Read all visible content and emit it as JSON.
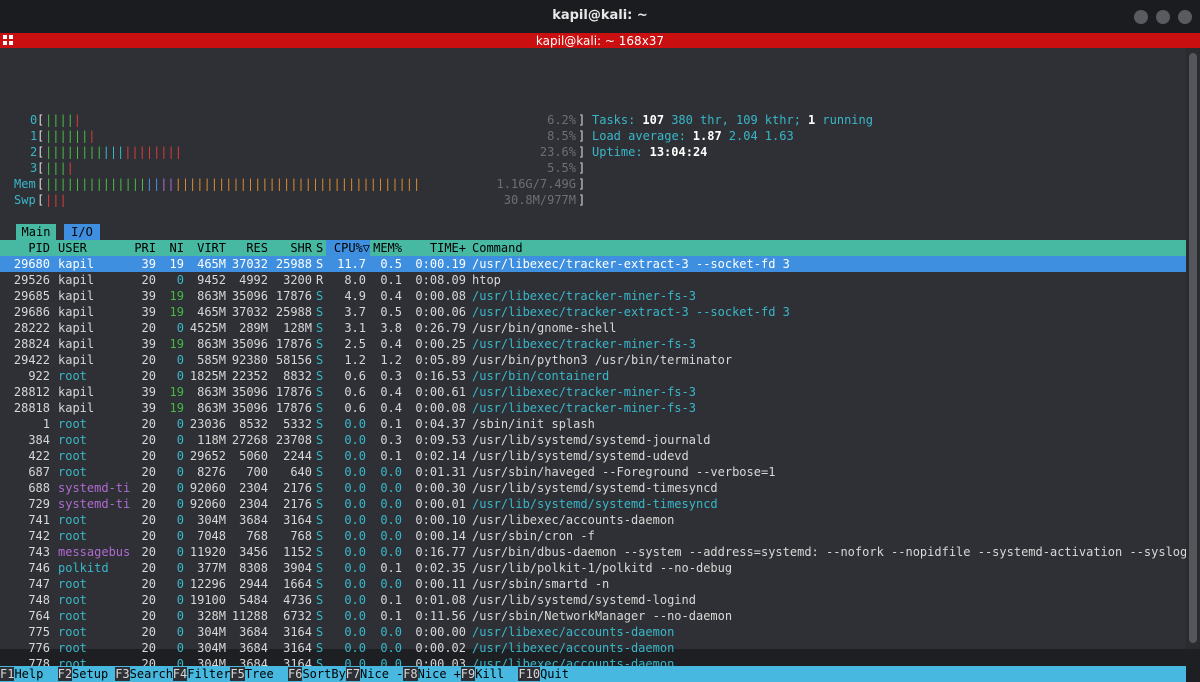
{
  "window": {
    "title": "kapil@kali: ~",
    "subtitle": "kapil@kali: ~ 168x37"
  },
  "meters": {
    "cpu": [
      {
        "label": "0",
        "value": "6.2%"
      },
      {
        "label": "1",
        "value": "8.5%"
      },
      {
        "label": "2",
        "value": "23.6%"
      },
      {
        "label": "3",
        "value": "5.5%"
      }
    ],
    "mem": {
      "label": "Mem",
      "value": "1.16G/7.49G"
    },
    "swp": {
      "label": "Swp",
      "value": "30.8M/977M"
    },
    "tasks": {
      "label": "Tasks:",
      "tasks": "107",
      "thr": "380",
      "thr_label": "thr,",
      "kthr": "109",
      "kthr_label": "kthr;",
      "running": "1",
      "running_label": "running"
    },
    "load": {
      "label": "Load average:",
      "v1": "1.87",
      "v2": "2.04",
      "v3": "1.63"
    },
    "uptime": {
      "label": "Uptime:",
      "value": "13:04:24"
    }
  },
  "tabs": [
    {
      "label": "Main"
    },
    {
      "label": "I/O"
    }
  ],
  "columns": {
    "pid": "PID",
    "user": "USER",
    "pri": "PRI",
    "ni": "NI",
    "virt": "VIRT",
    "res": "RES",
    "shr": "SHR",
    "s": "S",
    "cpu": "CPU%▽",
    "mem": "MEM%",
    "time": "TIME+",
    "cmd": "Command"
  },
  "processes": [
    {
      "pid": "29680",
      "user": "kapil",
      "pri": "39",
      "ni": "19",
      "virt": "465M",
      "res": "37032",
      "shr": "25988",
      "s": "S",
      "cpu": "11.7",
      "mem": "0.5",
      "time": "0:00.19",
      "cmd": "/usr/libexec/tracker-extract-3 --socket-fd 3"
    },
    {
      "pid": "29526",
      "user": "kapil",
      "pri": "20",
      "ni": "0",
      "virt": "9452",
      "res": "4992",
      "shr": "3200",
      "s": "R",
      "cpu": "8.0",
      "mem": "0.1",
      "time": "0:08.09",
      "cmd": "htop"
    },
    {
      "pid": "29685",
      "user": "kapil",
      "pri": "39",
      "ni": "19",
      "virt": "863M",
      "res": "35096",
      "shr": "17876",
      "s": "S",
      "cpu": "4.9",
      "mem": "0.4",
      "time": "0:00.08",
      "cmd": "/usr/libexec/tracker-miner-fs-3"
    },
    {
      "pid": "29686",
      "user": "kapil",
      "pri": "39",
      "ni": "19",
      "virt": "465M",
      "res": "37032",
      "shr": "25988",
      "s": "S",
      "cpu": "3.7",
      "mem": "0.5",
      "time": "0:00.06",
      "cmd": "/usr/libexec/tracker-extract-3 --socket-fd 3"
    },
    {
      "pid": "28222",
      "user": "kapil",
      "pri": "20",
      "ni": "0",
      "virt": "4525M",
      "res": "289M",
      "shr": "128M",
      "s": "S",
      "cpu": "3.1",
      "mem": "3.8",
      "time": "0:26.79",
      "cmd": "/usr/bin/gnome-shell"
    },
    {
      "pid": "28824",
      "user": "kapil",
      "pri": "39",
      "ni": "19",
      "virt": "863M",
      "res": "35096",
      "shr": "17876",
      "s": "S",
      "cpu": "2.5",
      "mem": "0.4",
      "time": "0:00.25",
      "cmd": "/usr/libexec/tracker-miner-fs-3"
    },
    {
      "pid": "29422",
      "user": "kapil",
      "pri": "20",
      "ni": "0",
      "virt": "585M",
      "res": "92380",
      "shr": "58156",
      "s": "S",
      "cpu": "1.2",
      "mem": "1.2",
      "time": "0:05.89",
      "cmd": "/usr/bin/python3 /usr/bin/terminator"
    },
    {
      "pid": "922",
      "user": "root",
      "pri": "20",
      "ni": "0",
      "virt": "1825M",
      "res": "22352",
      "shr": "8832",
      "s": "S",
      "cpu": "0.6",
      "mem": "0.3",
      "time": "0:16.53",
      "cmd": "/usr/bin/containerd"
    },
    {
      "pid": "28812",
      "user": "kapil",
      "pri": "39",
      "ni": "19",
      "virt": "863M",
      "res": "35096",
      "shr": "17876",
      "s": "S",
      "cpu": "0.6",
      "mem": "0.4",
      "time": "0:00.61",
      "cmd": "/usr/libexec/tracker-miner-fs-3"
    },
    {
      "pid": "28818",
      "user": "kapil",
      "pri": "39",
      "ni": "19",
      "virt": "863M",
      "res": "35096",
      "shr": "17876",
      "s": "S",
      "cpu": "0.6",
      "mem": "0.4",
      "time": "0:00.08",
      "cmd": "/usr/libexec/tracker-miner-fs-3"
    },
    {
      "pid": "1",
      "user": "root",
      "pri": "20",
      "ni": "0",
      "virt": "23036",
      "res": "8532",
      "shr": "5332",
      "s": "S",
      "cpu": "0.0",
      "mem": "0.1",
      "time": "0:04.37",
      "cmd": "/sbin/init splash"
    },
    {
      "pid": "384",
      "user": "root",
      "pri": "20",
      "ni": "0",
      "virt": "118M",
      "res": "27268",
      "shr": "23708",
      "s": "S",
      "cpu": "0.0",
      "mem": "0.3",
      "time": "0:09.53",
      "cmd": "/usr/lib/systemd/systemd-journald"
    },
    {
      "pid": "422",
      "user": "root",
      "pri": "20",
      "ni": "0",
      "virt": "29652",
      "res": "5060",
      "shr": "2244",
      "s": "S",
      "cpu": "0.0",
      "mem": "0.1",
      "time": "0:02.14",
      "cmd": "/usr/lib/systemd/systemd-udevd"
    },
    {
      "pid": "687",
      "user": "root",
      "pri": "20",
      "ni": "0",
      "virt": "8276",
      "res": "700",
      "shr": "640",
      "s": "S",
      "cpu": "0.0",
      "mem": "0.0",
      "time": "0:01.31",
      "cmd": "/usr/sbin/haveged --Foreground --verbose=1"
    },
    {
      "pid": "688",
      "user": "systemd-ti",
      "pri": "20",
      "ni": "0",
      "virt": "92060",
      "res": "2304",
      "shr": "2176",
      "s": "S",
      "cpu": "0.0",
      "mem": "0.0",
      "time": "0:00.30",
      "cmd": "/usr/lib/systemd/systemd-timesyncd"
    },
    {
      "pid": "729",
      "user": "systemd-ti",
      "pri": "20",
      "ni": "0",
      "virt": "92060",
      "res": "2304",
      "shr": "2176",
      "s": "S",
      "cpu": "0.0",
      "mem": "0.0",
      "time": "0:00.01",
      "cmd": "/usr/lib/systemd/systemd-timesyncd"
    },
    {
      "pid": "741",
      "user": "root",
      "pri": "20",
      "ni": "0",
      "virt": "304M",
      "res": "3684",
      "shr": "3164",
      "s": "S",
      "cpu": "0.0",
      "mem": "0.0",
      "time": "0:00.10",
      "cmd": "/usr/libexec/accounts-daemon"
    },
    {
      "pid": "742",
      "user": "root",
      "pri": "20",
      "ni": "0",
      "virt": "7048",
      "res": "768",
      "shr": "768",
      "s": "S",
      "cpu": "0.0",
      "mem": "0.0",
      "time": "0:00.14",
      "cmd": "/usr/sbin/cron -f"
    },
    {
      "pid": "743",
      "user": "messagebus",
      "pri": "20",
      "ni": "0",
      "virt": "11920",
      "res": "3456",
      "shr": "1152",
      "s": "S",
      "cpu": "0.0",
      "mem": "0.0",
      "time": "0:16.77",
      "cmd": "/usr/bin/dbus-daemon --system --address=systemd: --nofork --nopidfile --systemd-activation --syslog-o"
    },
    {
      "pid": "746",
      "user": "polkitd",
      "pri": "20",
      "ni": "0",
      "virt": "377M",
      "res": "8308",
      "shr": "3904",
      "s": "S",
      "cpu": "0.0",
      "mem": "0.1",
      "time": "0:02.35",
      "cmd": "/usr/lib/polkit-1/polkitd --no-debug"
    },
    {
      "pid": "747",
      "user": "root",
      "pri": "20",
      "ni": "0",
      "virt": "12296",
      "res": "2944",
      "shr": "1664",
      "s": "S",
      "cpu": "0.0",
      "mem": "0.0",
      "time": "0:00.11",
      "cmd": "/usr/sbin/smartd -n"
    },
    {
      "pid": "748",
      "user": "root",
      "pri": "20",
      "ni": "0",
      "virt": "19100",
      "res": "5484",
      "shr": "4736",
      "s": "S",
      "cpu": "0.0",
      "mem": "0.1",
      "time": "0:01.08",
      "cmd": "/usr/lib/systemd/systemd-logind"
    },
    {
      "pid": "764",
      "user": "root",
      "pri": "20",
      "ni": "0",
      "virt": "328M",
      "res": "11288",
      "shr": "6732",
      "s": "S",
      "cpu": "0.0",
      "mem": "0.1",
      "time": "0:11.56",
      "cmd": "/usr/sbin/NetworkManager --no-daemon"
    },
    {
      "pid": "775",
      "user": "root",
      "pri": "20",
      "ni": "0",
      "virt": "304M",
      "res": "3684",
      "shr": "3164",
      "s": "S",
      "cpu": "0.0",
      "mem": "0.0",
      "time": "0:00.00",
      "cmd": "/usr/libexec/accounts-daemon"
    },
    {
      "pid": "776",
      "user": "root",
      "pri": "20",
      "ni": "0",
      "virt": "304M",
      "res": "3684",
      "shr": "3164",
      "s": "S",
      "cpu": "0.0",
      "mem": "0.0",
      "time": "0:00.02",
      "cmd": "/usr/libexec/accounts-daemon"
    },
    {
      "pid": "778",
      "user": "root",
      "pri": "20",
      "ni": "0",
      "virt": "304M",
      "res": "3684",
      "shr": "3164",
      "s": "S",
      "cpu": "0.0",
      "mem": "0.0",
      "time": "0:00.03",
      "cmd": "/usr/libexec/accounts-daemon"
    }
  ],
  "function_keys": [
    {
      "key": "F1",
      "label": "Help"
    },
    {
      "key": "F2",
      "label": "Setup"
    },
    {
      "key": "F3",
      "label": "Search"
    },
    {
      "key": "F4",
      "label": "Filter"
    },
    {
      "key": "F5",
      "label": "Tree"
    },
    {
      "key": "F6",
      "label": "SortBy"
    },
    {
      "key": "F7",
      "label": "Nice -"
    },
    {
      "key": "F8",
      "label": "Nice +"
    },
    {
      "key": "F9",
      "label": "Kill"
    },
    {
      "key": "F10",
      "label": "Quit"
    }
  ],
  "colors": {
    "accent": "#47b9a2",
    "selection": "#3f8fe0",
    "titlebar_red": "#c90f0f",
    "function_bar": "#47b9e0"
  }
}
